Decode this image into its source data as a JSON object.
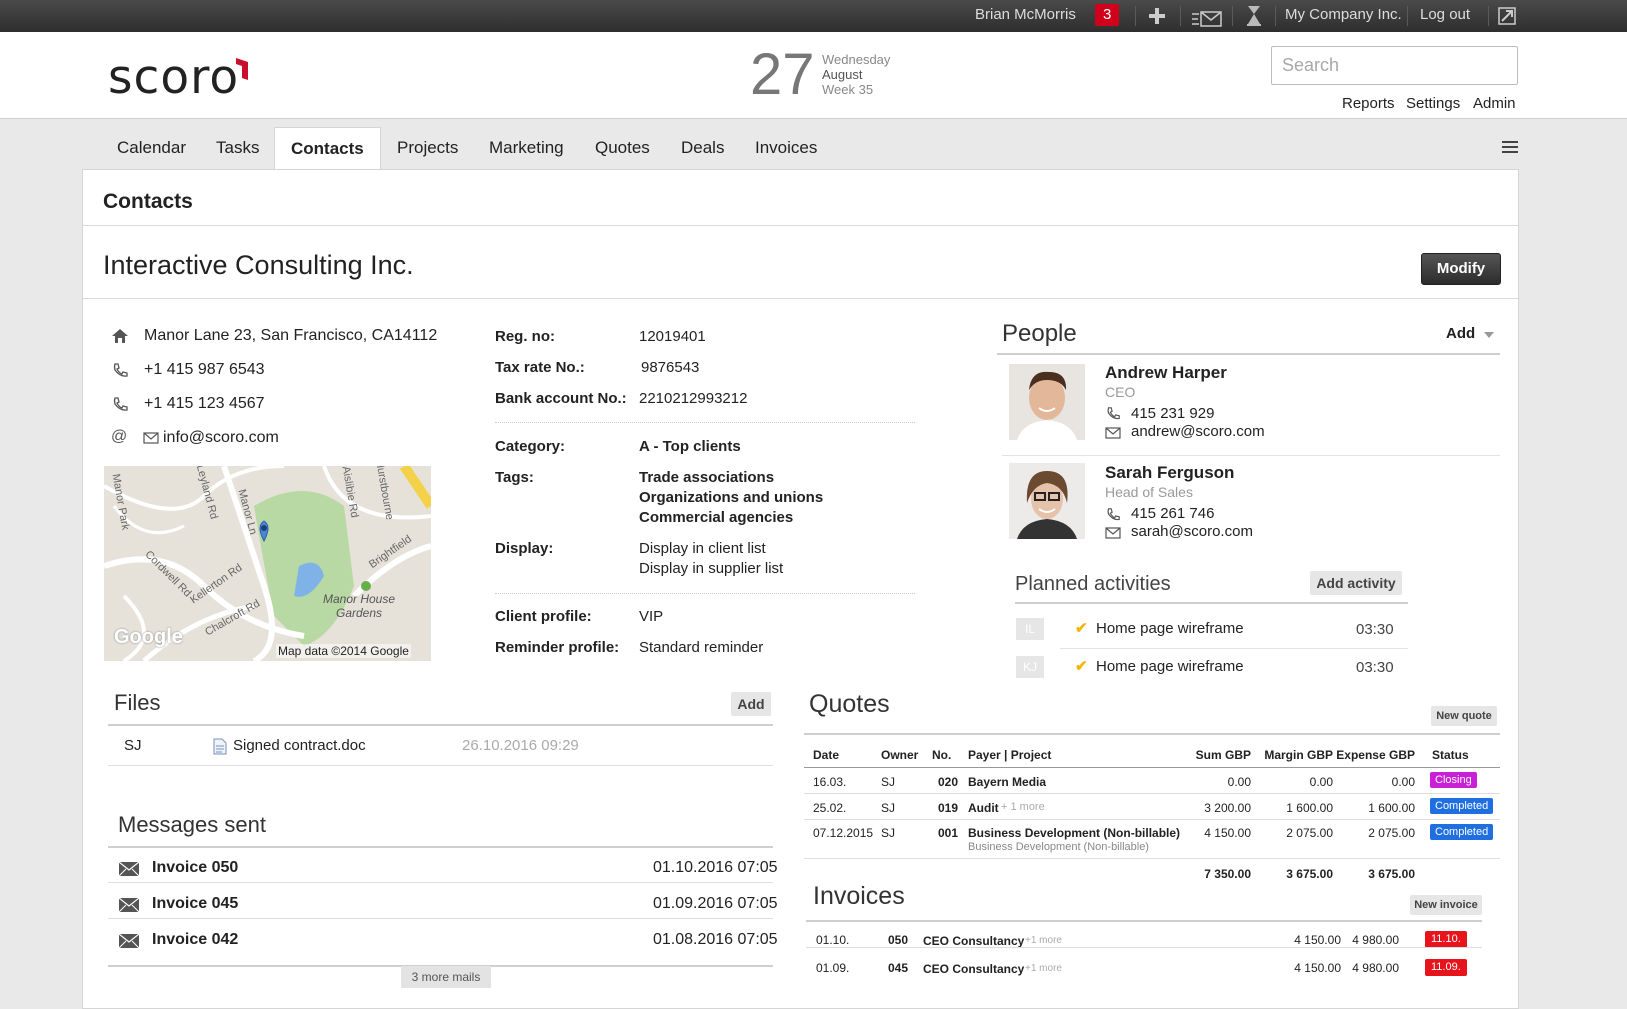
{
  "topbar": {
    "user": "Brian McMorris",
    "notifications": "3",
    "company": "My Company Inc.",
    "logout": "Log out"
  },
  "header": {
    "logo": "scoro",
    "date_day": "27",
    "weekday": "Wednesday",
    "month": "August",
    "week": "Week 35",
    "search_placeholder": "Search",
    "links": [
      "Reports",
      "Settings",
      "Admin"
    ]
  },
  "nav": {
    "tabs": [
      "Calendar",
      "Tasks",
      "Contacts",
      "Projects",
      "Marketing",
      "Quotes",
      "Deals",
      "Invoices"
    ],
    "active": "Contacts"
  },
  "page": {
    "title": "Contacts",
    "company": "Interactive Consulting Inc.",
    "modify_label": "Modify"
  },
  "contact": {
    "address": "Manor Lane 23, San Francisco, CA14112",
    "phone1": "+1 415 987 6543",
    "phone2": "+1 415 123 4567",
    "email": "info@scoro.com",
    "map_labels": [
      "Manor House Gardens",
      "Kellerton Rd",
      "Chalcroft Rd",
      "Cordwell Rd",
      "Brightfield",
      "Manor Ln",
      "Aislibie Rd",
      "Leyland Rd",
      "Hurstbourne",
      "Manor Park"
    ],
    "map_credit": "Map data ©2014 Google",
    "map_logo": "Google"
  },
  "details": {
    "reg_label": "Reg. no:",
    "reg_value": "12019401",
    "tax_label": "Tax rate No.:",
    "tax_value": "9876543",
    "bank_label": "Bank account No.:",
    "bank_value": "2210212993212",
    "category_label": "Category:",
    "category_value": "A - Top clients",
    "tags_label": "Tags:",
    "tags": [
      "Trade associations",
      "Organizations and unions",
      "Commercial agencies"
    ],
    "display_label": "Display:",
    "display": [
      "Display in client list",
      "Display in supplier list"
    ],
    "client_profile_label": "Client profile:",
    "client_profile_value": "VIP",
    "reminder_label": "Reminder profile:",
    "reminder_value": "Standard reminder"
  },
  "people": {
    "title": "People",
    "add_label": "Add",
    "list": [
      {
        "name": "Andrew Harper",
        "role": "CEO",
        "phone": "415 231 929",
        "email": "andrew@scoro.com"
      },
      {
        "name": "Sarah Ferguson",
        "role": "Head of Sales",
        "phone": "415 261 746",
        "email": "sarah@scoro.com"
      }
    ]
  },
  "activities": {
    "title": "Planned activities",
    "add_label": "Add activity",
    "items": [
      {
        "initials": "IL",
        "title": "Home page wireframe",
        "time": "03:30"
      },
      {
        "initials": "KJ",
        "title": "Home page wireframe",
        "time": "03:30"
      }
    ]
  },
  "files": {
    "title": "Files",
    "add_label": "Add",
    "items": [
      {
        "owner": "SJ",
        "name": "Signed contract.doc",
        "date": "26.10.2016 09:29"
      }
    ]
  },
  "messages": {
    "title": "Messages sent",
    "items": [
      {
        "title": "Invoice 050",
        "date": "01.10.2016 07:05"
      },
      {
        "title": "Invoice 045",
        "date": "01.09.2016 07:05"
      },
      {
        "title": "Invoice 042",
        "date": "01.08.2016 07:05"
      }
    ],
    "more_label": "3 more mails"
  },
  "quotes": {
    "title": "Quotes",
    "new_label": "New quote",
    "headers": [
      "Date",
      "Owner",
      "No.",
      "Payer | Project",
      "Sum GBP",
      "Margin GBP",
      "Expense GBP",
      "Status"
    ],
    "rows": [
      {
        "date": "16.03.",
        "owner": "SJ",
        "no": "020",
        "payer": "Bayern Media",
        "extra": "",
        "sub": "",
        "sum": "0.00",
        "margin": "0.00",
        "expense": "0.00",
        "status": "Closing",
        "status_color": "#c91fd6"
      },
      {
        "date": "25.02.",
        "owner": "SJ",
        "no": "019",
        "payer": "Audit",
        "extra": "+ 1 more",
        "sub": "",
        "sum": "3 200.00",
        "margin": "1 600.00",
        "expense": "1 600.00",
        "status": "Completed",
        "status_color": "#1f6fe0"
      },
      {
        "date": "07.12.2015",
        "owner": "SJ",
        "no": "001",
        "payer": "Business Development (Non-billable)",
        "extra": "",
        "sub": "Business Development (Non-billable)",
        "sum": "4 150.00",
        "margin": "2 075.00",
        "expense": "2 075.00",
        "status": "Completed",
        "status_color": "#1f6fe0"
      }
    ],
    "totals": {
      "sum": "7 350.00",
      "margin": "3 675.00",
      "expense": "3 675.00"
    }
  },
  "invoices": {
    "title": "Invoices",
    "new_label": "New invoice",
    "rows": [
      {
        "date": "01.10.",
        "no": "050",
        "title": "CEO Consultancy",
        "extra": "+1 more",
        "sum": "4 150.00",
        "total": "4 980.00",
        "due": "11.10."
      },
      {
        "date": "01.09.",
        "no": "045",
        "title": "CEO Consultancy",
        "extra": "+1 more",
        "sum": "4 150.00",
        "total": "4 980.00",
        "due": "11.09."
      }
    ]
  }
}
